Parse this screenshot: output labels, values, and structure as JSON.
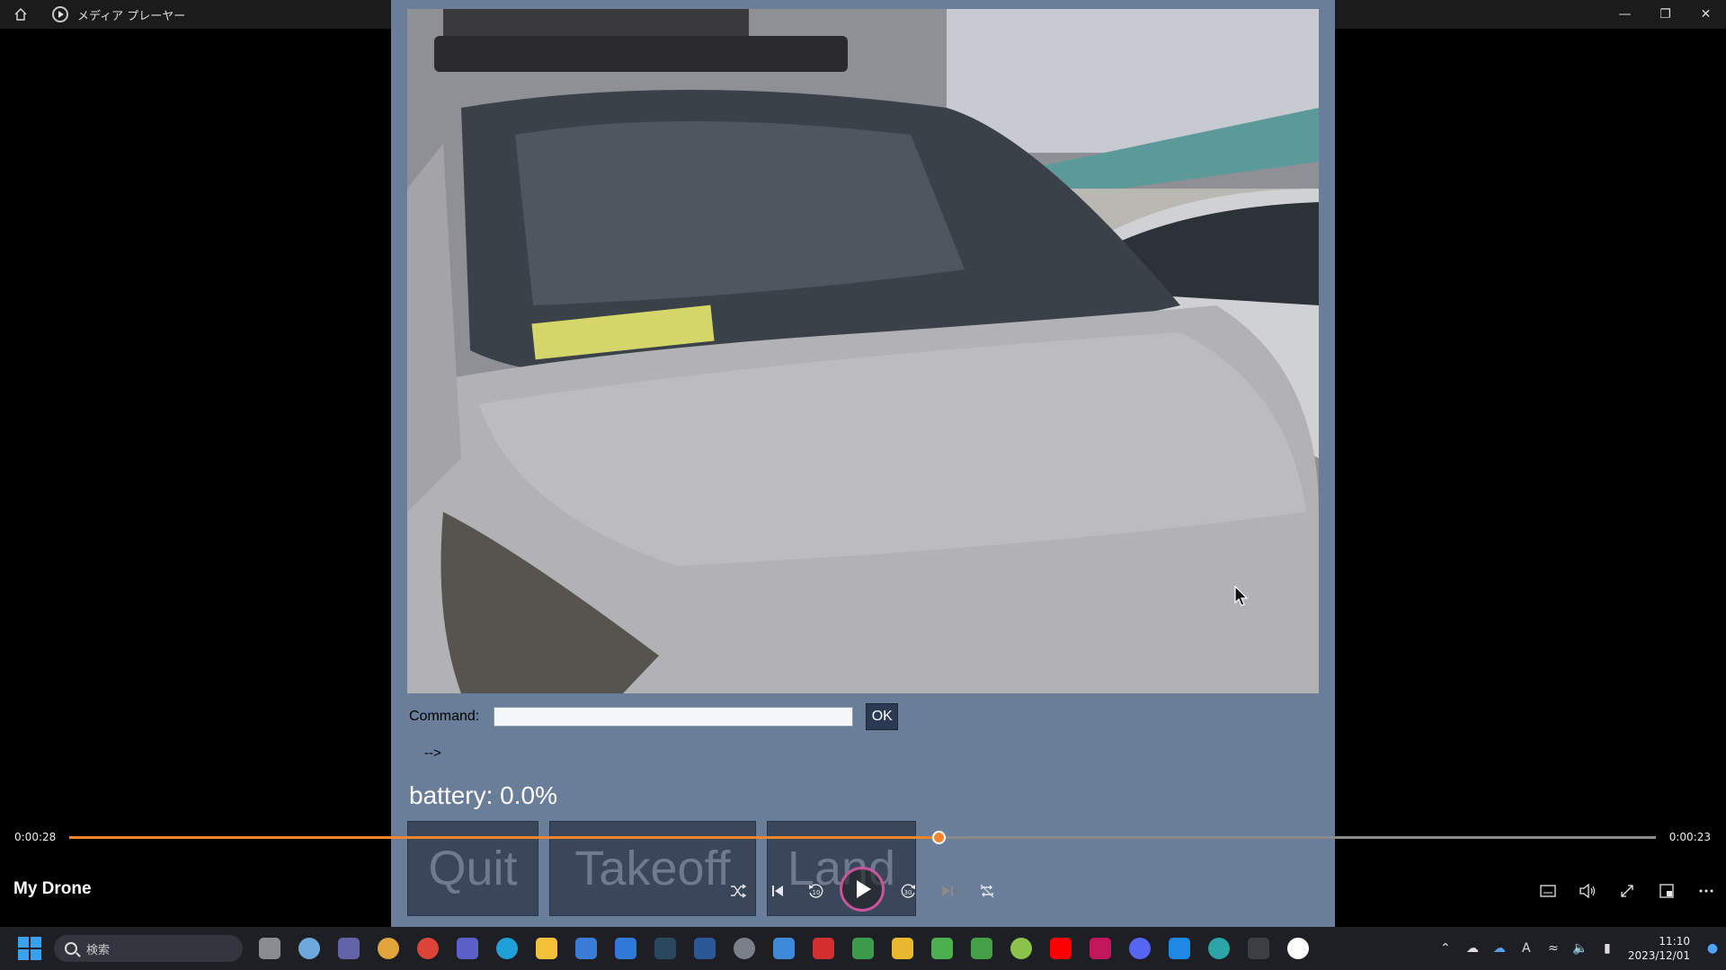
{
  "window": {
    "title": "メディア プレーヤー",
    "controls": [
      "minimize",
      "restore",
      "close"
    ]
  },
  "app": {
    "command_label": "Command:",
    "command_value": "",
    "ok_label": "OK",
    "arrow_text": "-->",
    "battery": "battery: 0.0%",
    "buttons": {
      "quit": "Quit",
      "takeoff": "Takeoff",
      "land": "Land"
    }
  },
  "player": {
    "title": "My Drone",
    "elapsed": "0:00:28",
    "remaining": "0:00:23",
    "progress": 0.548
  },
  "taskbar": {
    "search_placeholder": "検索",
    "clock_time": "11:10",
    "clock_date": "2023/12/01"
  },
  "colors": {
    "accent": "#f5852d",
    "app_background": "#6a7d99",
    "play_ring": "#c8559b"
  }
}
